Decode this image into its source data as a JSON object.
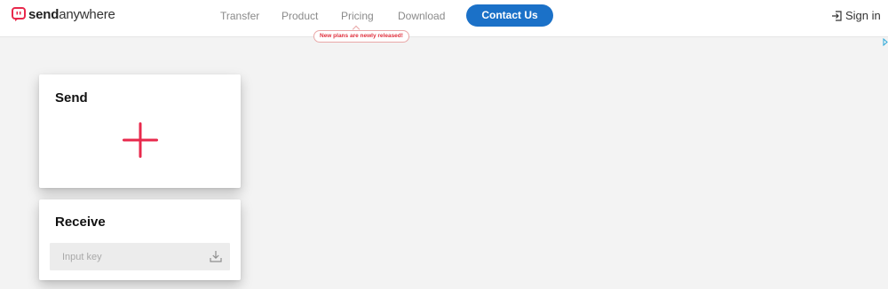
{
  "brand": {
    "name_bold": "send",
    "name_rest": "anywhere",
    "color": "#e8294c"
  },
  "nav": {
    "items": [
      {
        "label": "Transfer"
      },
      {
        "label": "Product"
      },
      {
        "label": "Pricing"
      },
      {
        "label": "Download"
      }
    ],
    "pricing_tooltip": "New plans are newly released!",
    "contact_label": "Contact Us",
    "contact_color": "#1b71c8",
    "signin_label": "Sign in",
    "signin_icon": "sign-in-icon"
  },
  "send": {
    "title": "Send",
    "add_icon": "plus-icon",
    "accent": "#e8294c"
  },
  "receive": {
    "title": "Receive",
    "input_placeholder": "Input key",
    "input_value": "",
    "submit_icon": "download-icon"
  }
}
